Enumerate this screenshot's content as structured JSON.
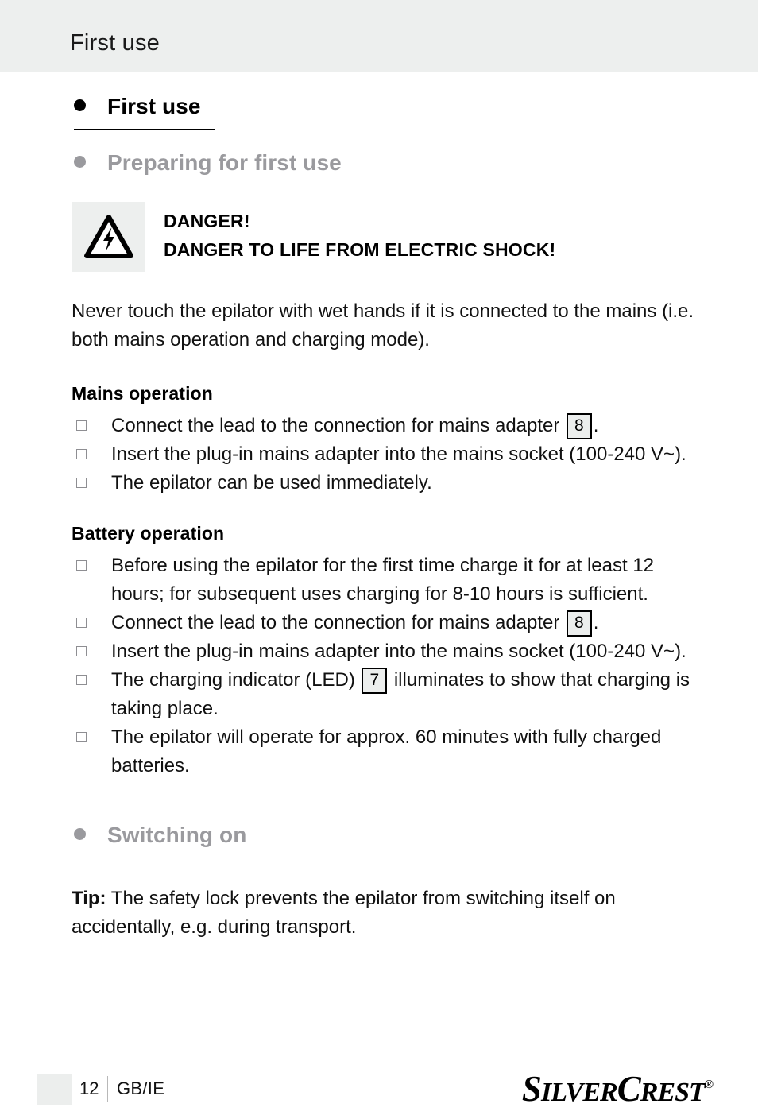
{
  "header": {
    "running_title": "First use"
  },
  "headings": {
    "h1": "First use",
    "h2": "Preparing for first use",
    "h3": "Switching on"
  },
  "danger": {
    "icon": "electric-shock-warning-icon",
    "line1": "DANGER!",
    "line2": "DANGER TO LIFE FROM ELECTRIC SHOCK!",
    "paragraph": "Never touch the epilator with wet hands if it is connected to the mains (i.e. both mains operation and charging mode)."
  },
  "mains_operation": {
    "subheading": "Mains operation",
    "items": [
      {
        "before": "Connect the lead to the connection for mains adapter",
        "ref": "8",
        "after": "."
      },
      {
        "before": "Insert the plug-in mains adapter into the mains socket (100-240 V~).",
        "ref": "",
        "after": ""
      },
      {
        "before": "The epilator can be used immediately.",
        "ref": "",
        "after": ""
      }
    ]
  },
  "battery_operation": {
    "subheading": "Battery operation",
    "items": [
      {
        "before": "Before using the epilator for the first time charge it for at least 12 hours; for subsequent uses charging for 8-10 hours is sufficient.",
        "ref": "",
        "after": ""
      },
      {
        "before": "Connect the lead to the connection for mains adapter",
        "ref": "8",
        "after": "."
      },
      {
        "before": "Insert the plug-in mains adapter into the mains socket (100-240 V~).",
        "ref": "",
        "after": ""
      },
      {
        "before": "The charging indicator (LED)",
        "ref": "7",
        "after": "illuminates to show that charging is taking place."
      },
      {
        "before": "The epilator will operate for approx. 60 minutes with fully charged batteries.",
        "ref": "",
        "after": ""
      }
    ]
  },
  "switching_on": {
    "tip_label": "Tip:",
    "tip_text": " The safety lock prevents the epilator from switching itself on accidentally, e.g. during transport."
  },
  "footer": {
    "page_number": "12",
    "language": "GB/IE",
    "brand_part1": "S",
    "brand_part2": "ILVER",
    "brand_part3": "C",
    "brand_part4": "REST",
    "brand_registered": "®"
  },
  "colors": {
    "header_band": "#edefee",
    "gray_heading": "#9a9a9e",
    "text": "#111111",
    "ref_box_fill": "#eceeed"
  }
}
